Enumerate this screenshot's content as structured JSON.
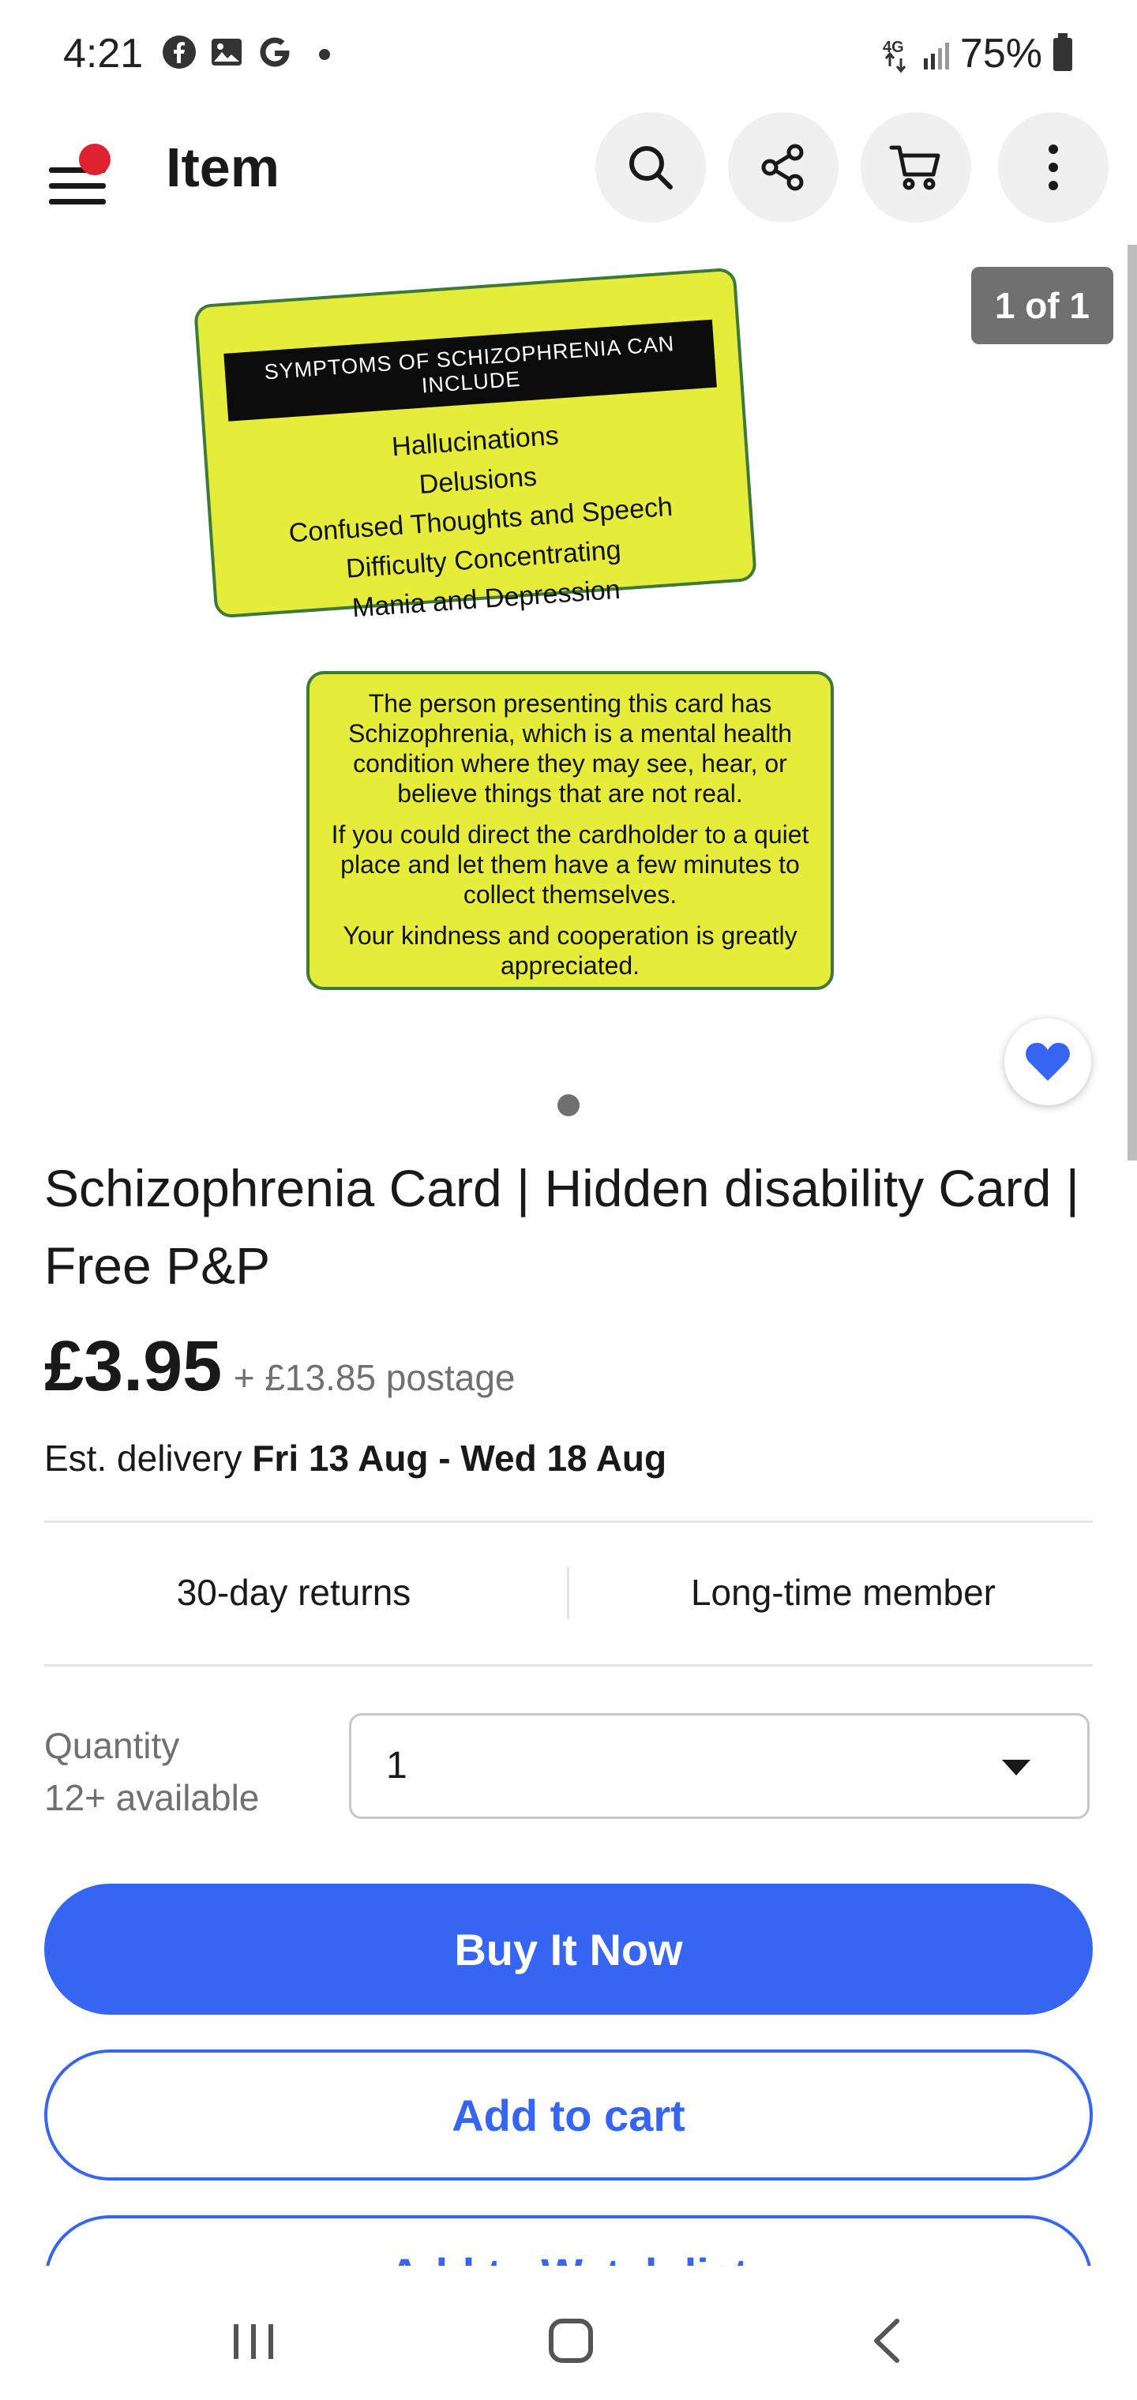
{
  "status_bar": {
    "time": "4:21",
    "network": "4G",
    "battery": "75%",
    "notification_icons": [
      "facebook-icon",
      "gallery-icon",
      "google-icon"
    ]
  },
  "app_bar": {
    "title": "Item",
    "actions": [
      "search-icon",
      "share-icon",
      "cart-icon",
      "more-icon"
    ]
  },
  "gallery": {
    "counter": "1 of 1",
    "card_front": {
      "header": "SYMPTOMS OF SCHIZOPHRENIA CAN INCLUDE",
      "lines": [
        "Hallucinations",
        "Delusions",
        "Confused Thoughts and Speech",
        "Difficulty Concentrating",
        "Mania and Depression"
      ]
    },
    "card_back": {
      "paragraph_1": "The person presenting this card has Schizophrenia, which is a mental health condition where they may see, hear, or believe things that are not real.",
      "paragraph_2": "If you could direct the cardholder to a quiet place and let them have a few minutes to collect themselves.",
      "paragraph_3": "Your kindness and cooperation is greatly appreciated."
    },
    "colors": {
      "card_fill": "#e6ec3a",
      "card_border": "#3d7a3a"
    }
  },
  "product": {
    "title": "Schizophrenia Card | Hidden disability Card | Free P&P",
    "price": "£3.95",
    "postage": "+ £13.85 postage",
    "delivery_prefix": "Est. delivery ",
    "delivery_dates": "Fri 13 Aug - Wed 18 Aug",
    "features": [
      "30-day returns",
      "Long-time member"
    ]
  },
  "quantity": {
    "label": "Quantity",
    "available": "12+ available",
    "selected": "1"
  },
  "actions": {
    "buy_now": "Buy It Now",
    "add_to_cart": "Add to cart",
    "add_to_watchlist": "Add to Watch list"
  },
  "colors": {
    "accent": "#3665f3",
    "notification_dot": "#e0212f"
  }
}
